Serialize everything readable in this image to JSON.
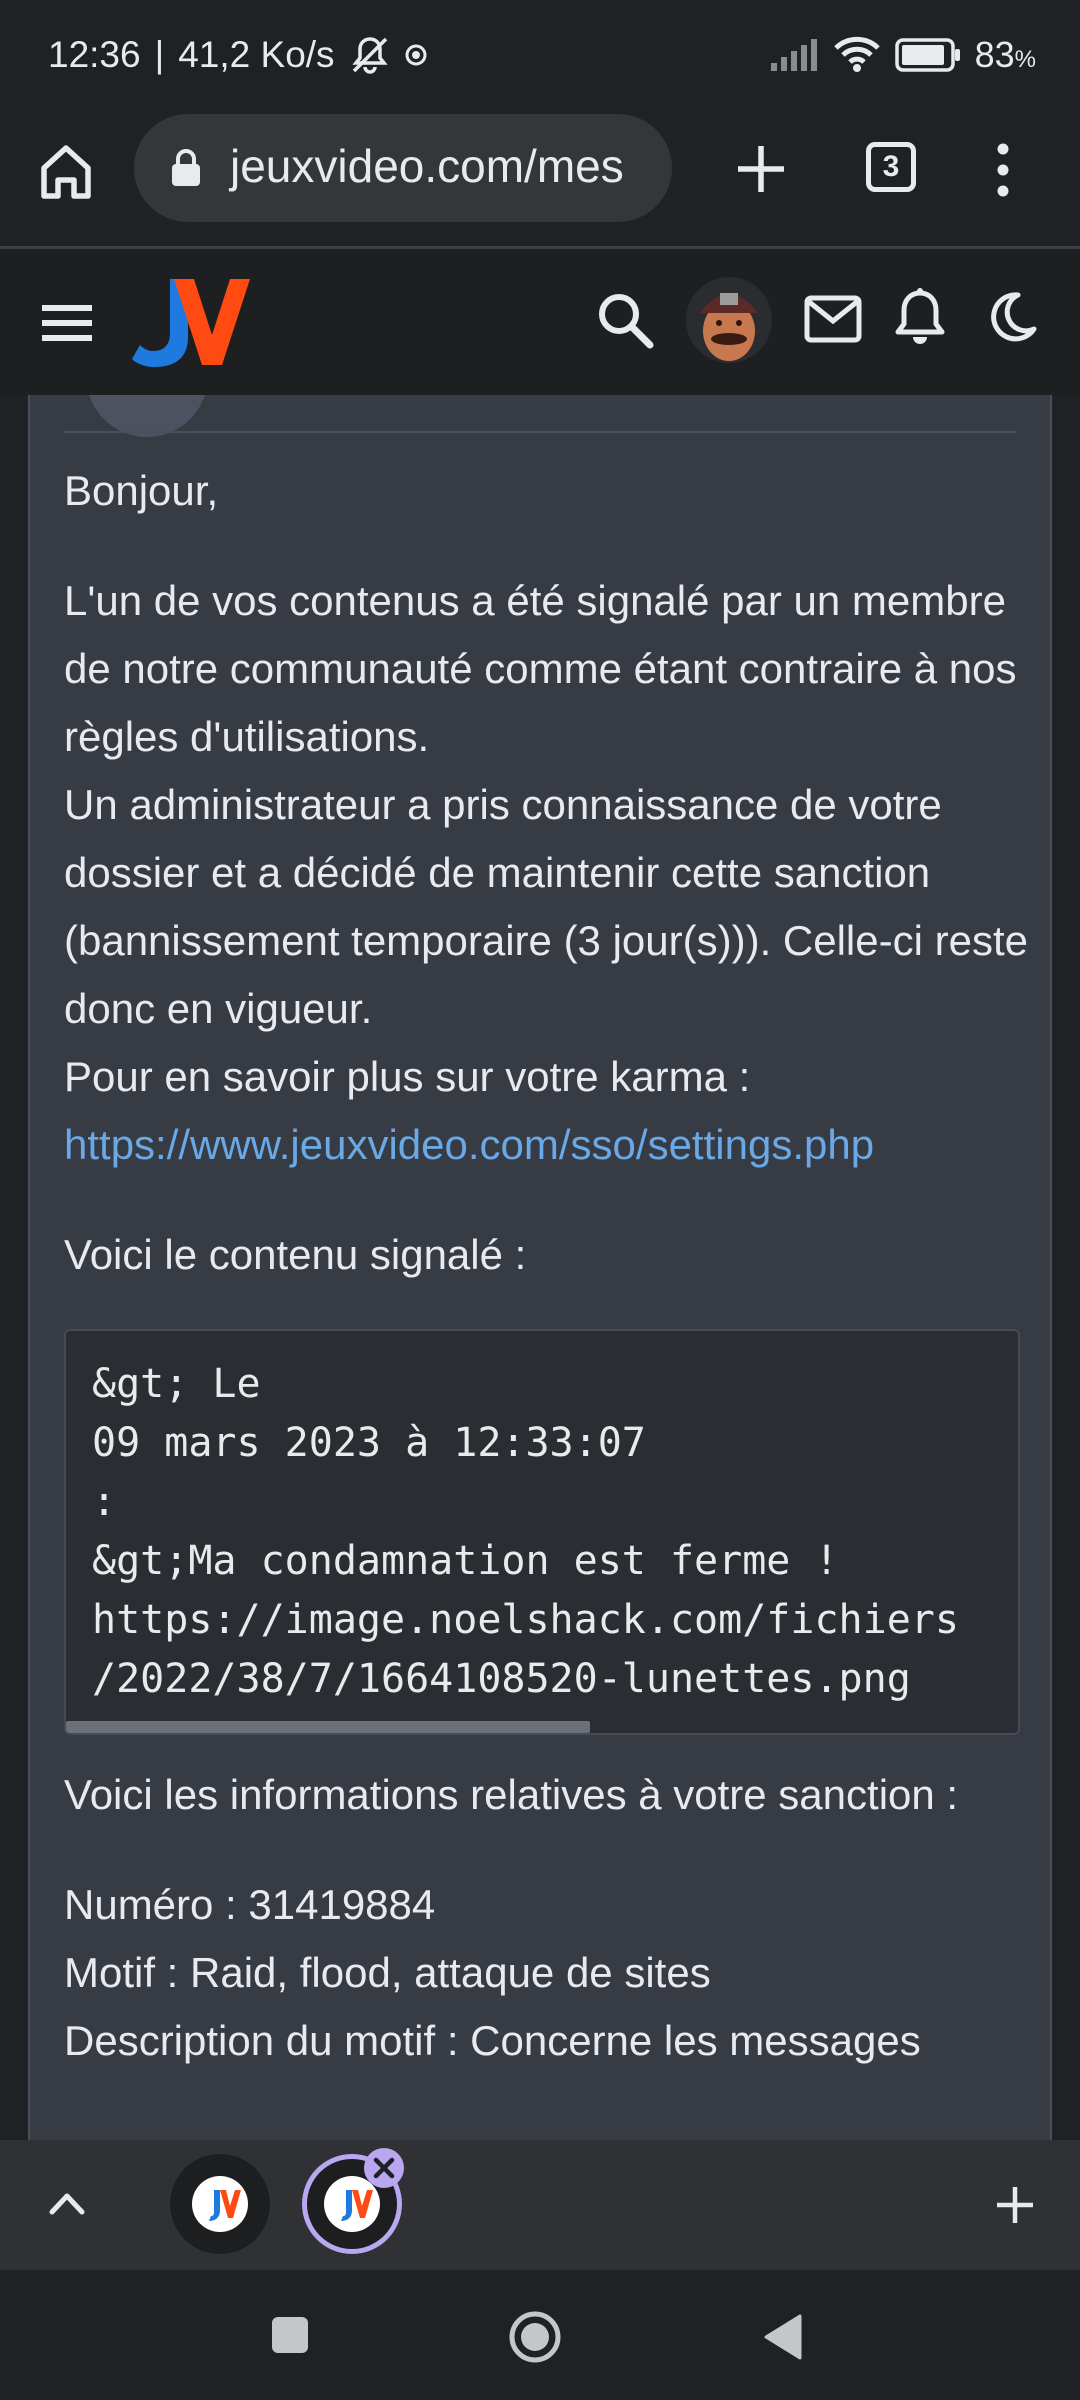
{
  "status_bar": {
    "time": "12:36",
    "separator": "|",
    "net_speed": "41,2 Ko/s",
    "battery_percent": "83",
    "battery_unit": "%"
  },
  "browser": {
    "url_display": "jeuxvideo.com/mes",
    "tab_count": "3"
  },
  "message": {
    "greeting": "Bonjour,",
    "paragraph_lines": [
      "L'un de vos contenus a été signalé par un membre de notre communauté comme étant contraire à nos règles d'utilisations.",
      "Un administrateur a pris connaissance de votre dossier et a décidé de maintenir cette sanction (bannissement temporaire (3 jour(s))). Celle-ci reste donc en vigueur.",
      "Pour en savoir plus sur votre karma :"
    ],
    "karma_link": "https://www.jeuxvideo.com/sso/settings.php",
    "reported_intro": "Voici le contenu signalé :",
    "reported_content": "&gt; Le\n09 mars 2023 à 12:33:07\n:\n&gt;Ma condamnation est ferme !\nhttps://image.noelshack.com/fichiers\n/2022/38/7/1664108520-lunettes.png",
    "sanction_intro": "Voici les informations relatives à votre sanction :",
    "sanction_number": "Numéro : 31419884",
    "sanction_reason": "Motif : Raid, flood, attaque de sites",
    "sanction_description": "Description du motif : Concerne les messages"
  },
  "colors": {
    "link": "#6aa8e6",
    "logo_blue": "#1f7ae0",
    "logo_orange": "#ff4a12",
    "card_background": "#363b44",
    "active_tab_ring": "#b9a7ef"
  },
  "icons": {
    "home": "home-icon",
    "lock": "lock-icon",
    "new_tab": "plus-icon",
    "menu": "kebab-menu-icon",
    "hamburger": "hamburger-icon",
    "search": "search-icon",
    "mail": "mail-icon",
    "bell": "bell-icon",
    "dark_mode": "moon-icon",
    "collapse": "chevron-up-icon",
    "close_tab": "close-icon",
    "nav_recent": "square-icon",
    "nav_home": "circle-icon",
    "nav_back": "triangle-back-icon"
  }
}
